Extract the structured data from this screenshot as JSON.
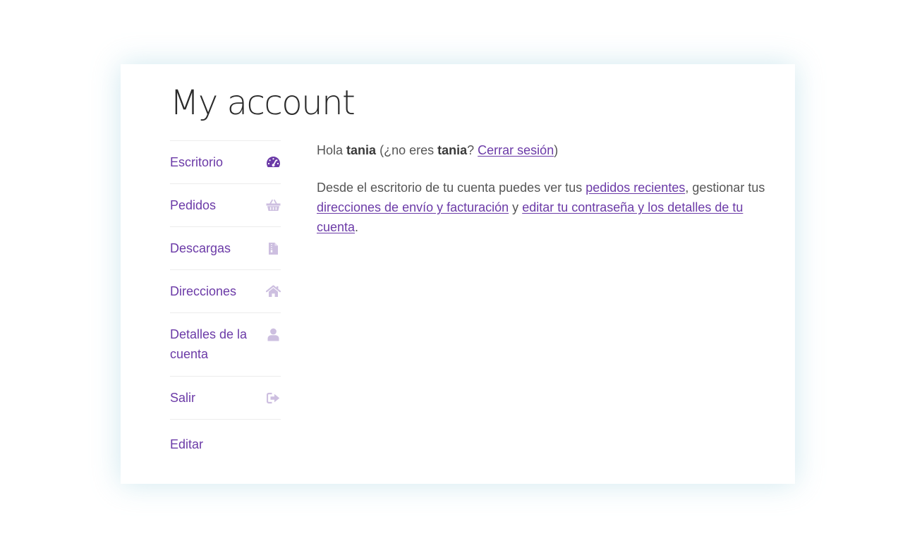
{
  "page": {
    "title": "My account"
  },
  "nav": {
    "items": [
      {
        "label": "Escritorio",
        "icon": "dashboard-icon",
        "color": "#6b3aa7"
      },
      {
        "label": "Pedidos",
        "icon": "basket-icon",
        "color": "#cdbfe0"
      },
      {
        "label": "Descargas",
        "icon": "file-icon",
        "color": "#cdbfe0"
      },
      {
        "label": "Direcciones",
        "icon": "home-icon",
        "color": "#cdbfe0"
      },
      {
        "label": "Detalles de la cuenta",
        "icon": "user-icon",
        "color": "#cdbfe0"
      },
      {
        "label": "Salir",
        "icon": "sign-out-icon",
        "color": "#cdbfe0"
      }
    ],
    "edit_label": "Editar"
  },
  "content": {
    "greeting": {
      "hello": "Hola",
      "username": "tania",
      "not_you_prefix": "(¿no eres",
      "question_mark": "?",
      "logout_link": "Cerrar sesión",
      "close_paren": ")"
    },
    "dashboard_text": {
      "intro": "Desde el escritorio de tu cuenta puedes ver tus",
      "orders_link": "pedidos recientes",
      "manage": ", gestionar tus",
      "addresses_link": "direcciones de envío y facturación",
      "and": "y",
      "account_link": "editar tu contraseña y los detalles de tu cuenta",
      "period": "."
    }
  },
  "colors": {
    "accent": "#6b3aa7",
    "icon_muted": "#cdbfe0",
    "text": "#555555",
    "title": "#2b2b2b",
    "divider": "#ececec"
  }
}
